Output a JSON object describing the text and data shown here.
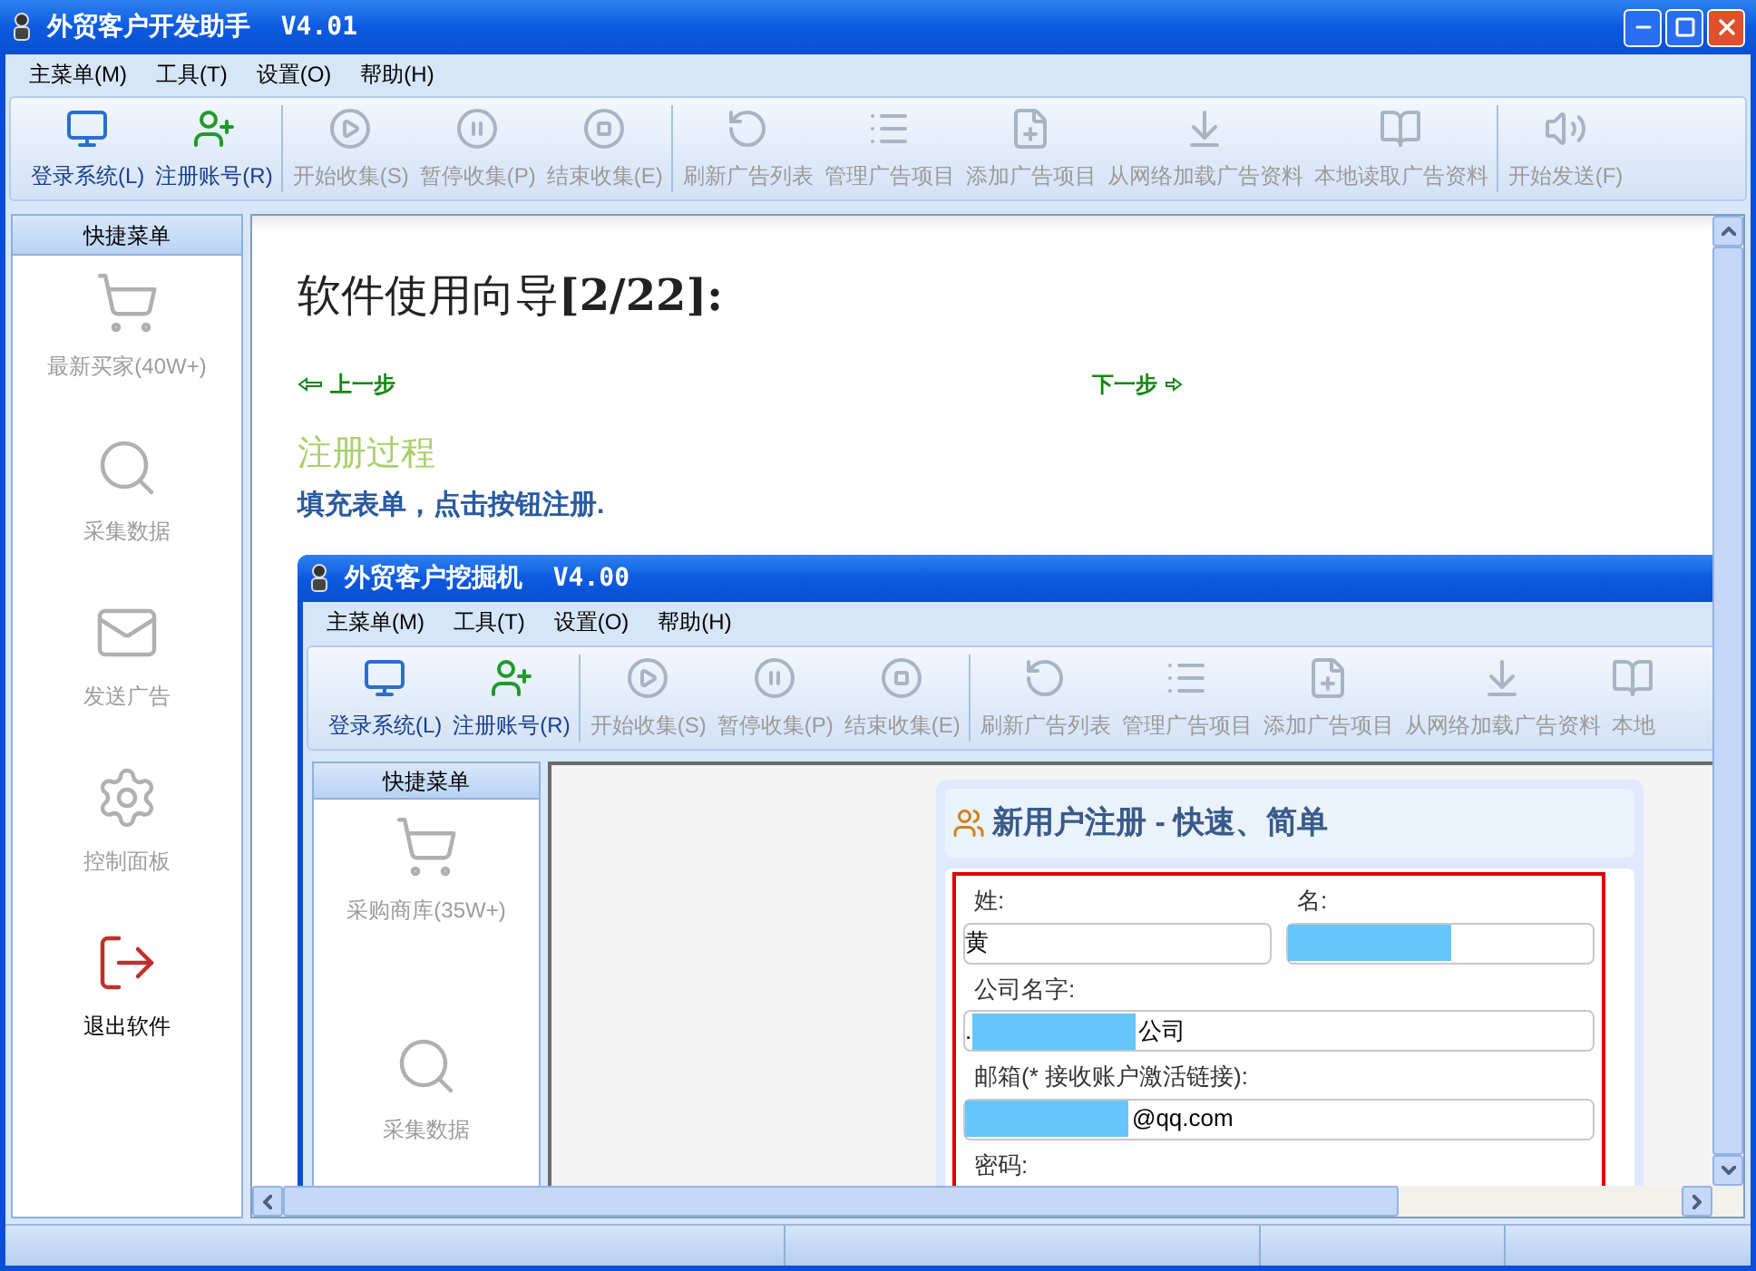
{
  "window": {
    "title": "外贸客户开发助手  V4.01"
  },
  "menu": [
    {
      "label": "主菜单(M)"
    },
    {
      "label": "工具(T)"
    },
    {
      "label": "设置(O)"
    },
    {
      "label": "帮助(H)"
    }
  ],
  "toolbar": [
    {
      "label": "登录系统(L)",
      "disabled": false
    },
    {
      "label": "注册账号(R)",
      "disabled": false
    },
    {
      "label": "开始收集(S)",
      "disabled": true
    },
    {
      "label": "暂停收集(P)",
      "disabled": true
    },
    {
      "label": "结束收集(E)",
      "disabled": true
    },
    {
      "label": "刷新广告列表",
      "disabled": true
    },
    {
      "label": "管理广告项目",
      "disabled": true
    },
    {
      "label": "添加广告项目",
      "disabled": true
    },
    {
      "label": "从网络加载广告资料",
      "disabled": true
    },
    {
      "label": "本地读取广告资料",
      "disabled": true
    },
    {
      "label": "开始发送(F)",
      "disabled": true
    }
  ],
  "sidebar": {
    "title": "快捷菜单",
    "items": [
      {
        "label": "最新买家(40W+)",
        "disabled": true
      },
      {
        "label": "采集数据",
        "disabled": true
      },
      {
        "label": "发送广告",
        "disabled": true
      },
      {
        "label": "控制面板",
        "disabled": true
      },
      {
        "label": "退出软件",
        "disabled": false
      }
    ]
  },
  "guide": {
    "heading": "软件使用向导**[2/22]:**",
    "prev": "上一步",
    "next": "下一步",
    "section_title": "注册过程",
    "instruction": "填充表单，点击按钮注册."
  },
  "inner_window": {
    "title": "外贸客户挖掘机  V4.00",
    "menu": [
      {
        "label": "主菜单(M)"
      },
      {
        "label": "工具(T)"
      },
      {
        "label": "设置(O)"
      },
      {
        "label": "帮助(H)"
      }
    ],
    "toolbar": [
      {
        "label": "登录系统(L)",
        "disabled": false
      },
      {
        "label": "注册账号(R)",
        "disabled": false
      },
      {
        "label": "开始收集(S)",
        "disabled": true
      },
      {
        "label": "暂停收集(P)",
        "disabled": true
      },
      {
        "label": "结束收集(E)",
        "disabled": true
      },
      {
        "label": "刷新广告列表",
        "disabled": true
      },
      {
        "label": "管理广告项目",
        "disabled": true
      },
      {
        "label": "添加广告项目",
        "disabled": true
      },
      {
        "label": "从网络加载广告资料",
        "disabled": true
      },
      {
        "label": "本地",
        "disabled": true
      }
    ],
    "sidebar": {
      "title": "快捷菜单",
      "items": [
        {
          "label": "采购商库(35W+)",
          "disabled": true
        },
        {
          "label": "采集数据",
          "disabled": true
        }
      ]
    },
    "form": {
      "title": "新用户注册 - 快速、简单",
      "fields": [
        {
          "kind": "half",
          "label": "姓:",
          "value": "黄",
          "redacted": false
        },
        {
          "kind": "half",
          "label": "名:",
          "redacted": true
        },
        {
          "kind": "full",
          "label": "公司名字:",
          "value": ".",
          "redacted": true,
          "value_end": "公司"
        },
        {
          "kind": "full",
          "label": "邮箱(* 接收账户激活链接):",
          "redacted": true,
          "value_end": "@qq.com"
        },
        {
          "kind": "full",
          "label": "密码:"
        }
      ]
    }
  }
}
